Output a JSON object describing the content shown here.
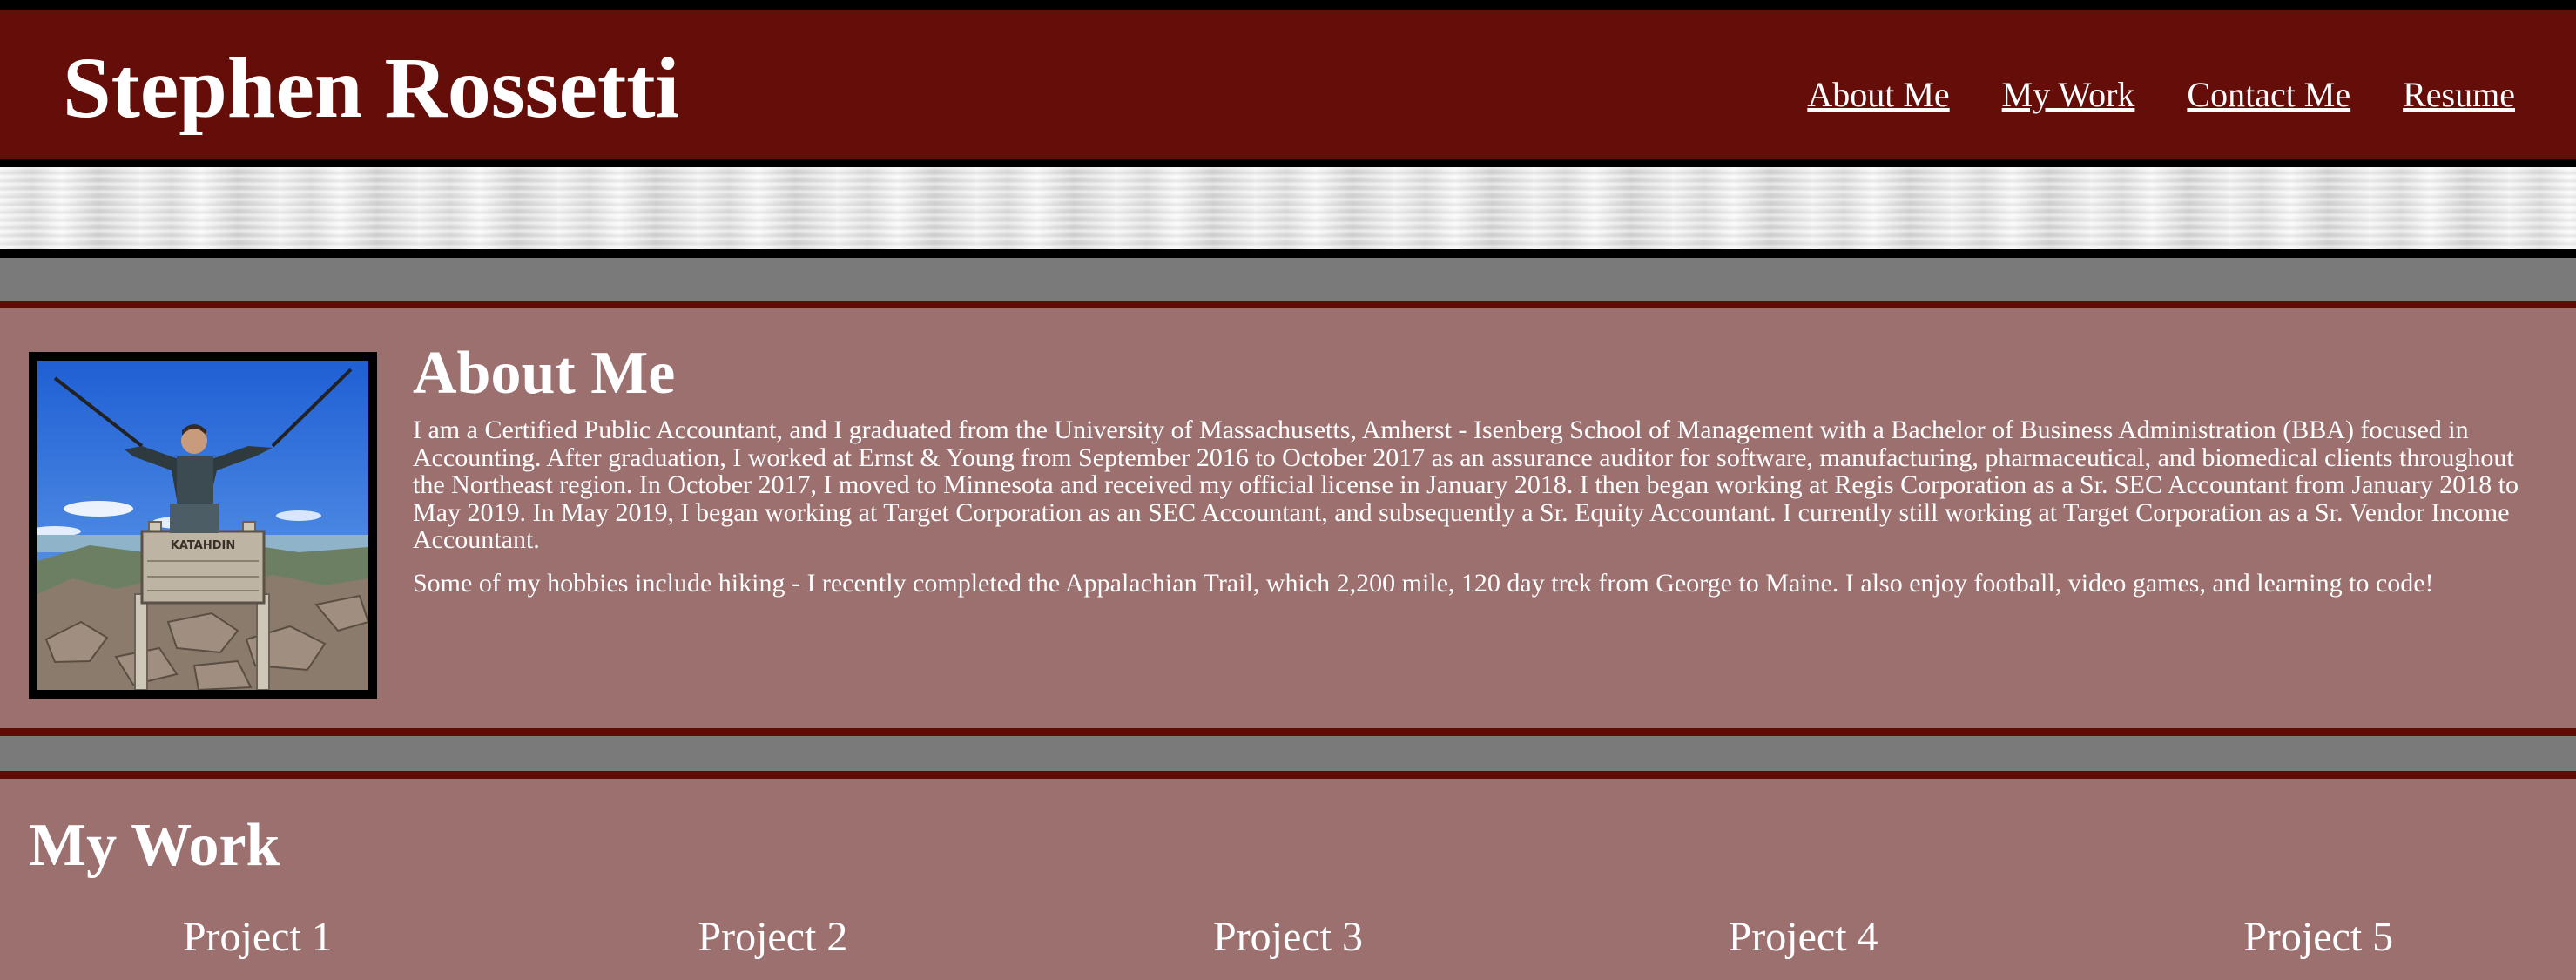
{
  "header": {
    "site_title": "Stephen Rossetti",
    "nav": [
      "About Me",
      "My Work",
      "Contact Me",
      "Resume"
    ]
  },
  "about": {
    "heading": "About Me",
    "photo_alt": "Summit photo at Katahdin",
    "paragraphs": [
      "I am a Certified Public Accountant, and I graduated from the University of Massachusetts, Amherst - Isenberg School of Management with a Bachelor of Business Administration (BBA) focused in Accounting. After graduation, I worked at Ernst & Young from September 2016 to October 2017 as an assurance auditor for software, manufacturing, pharmaceutical, and biomedical clients throughout the Northeast region. In October 2017, I moved to Minnesota and received my official license in January 2018. I then began working at Regis Corporation as a Sr. SEC Accountant from January 2018 to May 2019. In May 2019, I began working at Target Corporation as an SEC Accountant, and subsequently a Sr. Equity Accountant. I currently still working at Target Corporation as a Sr. Vendor Income Accountant.",
      "Some of my hobbies include hiking - I recently completed the Appalachian Trail, which 2,200 mile, 120 day trek from George to Maine. I also enjoy football, video games, and learning to code!"
    ],
    "sign_text": "KATAHDIN"
  },
  "work": {
    "heading": "My Work",
    "projects": [
      "Project 1",
      "Project 2",
      "Project 3",
      "Project 4",
      "Project 5"
    ]
  },
  "colors": {
    "header_bg": "#650e09",
    "section_bg": "#9d7070",
    "divider_bg": "#7a7a7a",
    "border_red": "#5f0c07"
  }
}
